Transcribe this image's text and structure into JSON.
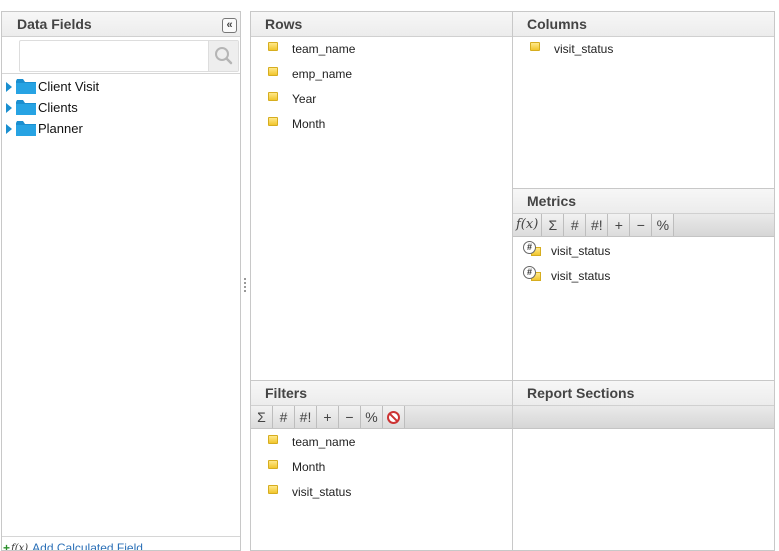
{
  "data_fields": {
    "title": "Data Fields",
    "collapse_label": "«",
    "search": {
      "value": "",
      "placeholder": ""
    },
    "tree": [
      {
        "label": "Client Visit"
      },
      {
        "label": "Clients"
      },
      {
        "label": "Planner"
      }
    ],
    "add_calculated_label": "Add Calculated Field"
  },
  "rows": {
    "title": "Rows",
    "items": [
      "team_name",
      "emp_name",
      "Year",
      "Month"
    ]
  },
  "columns": {
    "title": "Columns",
    "items": [
      "visit_status"
    ]
  },
  "metrics": {
    "title": "Metrics",
    "toolbar": [
      "f(x)",
      "Σ",
      "#",
      "#!",
      "+",
      "−",
      "%"
    ],
    "items": [
      "visit_status",
      "visit_status"
    ]
  },
  "filters": {
    "title": "Filters",
    "toolbar": [
      "Σ",
      "#",
      "#!",
      "+",
      "−",
      "%"
    ],
    "items": [
      "team_name",
      "Month",
      "visit_status"
    ]
  },
  "report_sections": {
    "title": "Report Sections"
  },
  "colors": {
    "accent_blue": "#1a8fd0",
    "field_yellow": "#f1c62d",
    "link_blue": "#2a6fb7"
  }
}
